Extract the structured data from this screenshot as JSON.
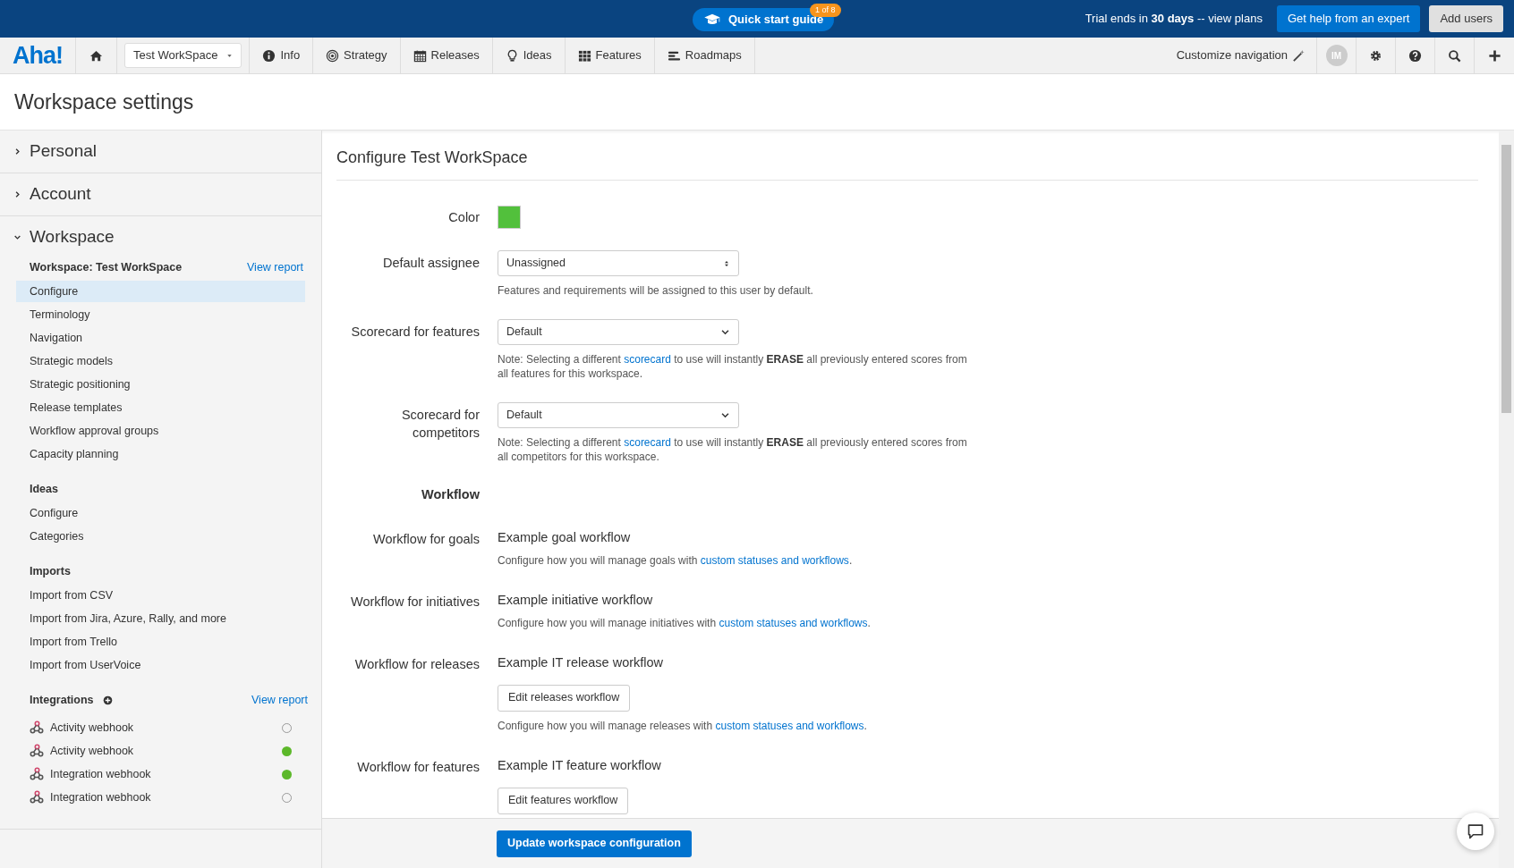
{
  "top_bar": {
    "guide": {
      "label": "Quick start guide",
      "badge": "1 of 8"
    },
    "trial_text": "Trial ends in **30 days** -- view plans",
    "buttons": [
      {
        "label": "Get help from an expert",
        "kind": "primary"
      },
      {
        "label": "Add users",
        "kind": "secondary"
      }
    ]
  },
  "nav": {
    "logo": "Aha!",
    "workspace": "Test WorkSpace",
    "items": [
      {
        "label": "Info"
      },
      {
        "label": "Strategy"
      },
      {
        "label": "Releases"
      },
      {
        "label": "Ideas"
      },
      {
        "label": "Features"
      },
      {
        "label": "Roadmaps"
      }
    ],
    "customize": "Customize navigation",
    "avatar": "IM"
  },
  "page_title": "Workspace settings",
  "sidebar": {
    "sections": [
      {
        "label": "Personal",
        "expanded": false
      },
      {
        "label": "Account",
        "expanded": false
      },
      {
        "label": "Workspace",
        "expanded": true,
        "groups": [
          {
            "title": "Workspace: Test WorkSpace",
            "link": "View report",
            "items": [
              {
                "label": "Configure",
                "selected": true
              },
              {
                "label": "Terminology",
                "selected": false
              },
              {
                "label": "Navigation",
                "selected": false
              },
              {
                "label": "Strategic models",
                "selected": false
              },
              {
                "label": "Strategic positioning",
                "selected": false
              },
              {
                "label": "Release templates",
                "selected": false
              },
              {
                "label": "Workflow approval groups",
                "selected": false
              },
              {
                "label": "Capacity planning",
                "selected": false
              }
            ]
          },
          {
            "title": "Ideas",
            "items": [
              {
                "label": "Configure",
                "selected": false
              },
              {
                "label": "Categories",
                "selected": false
              }
            ]
          },
          {
            "title": "Imports",
            "items": [
              {
                "label": "Import from CSV",
                "selected": false
              },
              {
                "label": "Import from Jira, Azure, Rally, and more",
                "selected": false
              },
              {
                "label": "Import from Trello",
                "selected": false
              },
              {
                "label": "Import from UserVoice",
                "selected": false
              }
            ]
          },
          {
            "title": "Integrations",
            "addable": true,
            "link": "View report",
            "integrations": [
              {
                "label": "Activity webhook",
                "active": false
              },
              {
                "label": "Activity webhook",
                "active": true
              },
              {
                "label": "Integration webhook",
                "active": true
              },
              {
                "label": "Integration webhook",
                "active": false
              }
            ]
          }
        ]
      }
    ]
  },
  "form": {
    "title": "Configure Test WorkSpace",
    "rows": [
      {
        "kind": "color",
        "label": "Color",
        "color": "#52c03c"
      },
      {
        "kind": "picker",
        "label": "Default assignee",
        "value": "Unassigned",
        "help": {
          "text": "Features and requirements will be assigned to this user by default."
        }
      },
      {
        "kind": "select",
        "label": "Scorecard for features",
        "value": "Default",
        "help": {
          "text": "Note: Selecting a different ",
          "link": "scorecard",
          "after": " to use will instantly **ERASE** all previously entered scores from all features for this workspace."
        }
      },
      {
        "kind": "select",
        "label": "Scorecard for competitors",
        "value": "Default",
        "help": {
          "text": "Note: Selecting a different ",
          "link": "scorecard",
          "after": " to use will instantly **ERASE** all previously entered scores from all competitors for this workspace."
        }
      },
      {
        "kind": "heading",
        "label": "Workflow"
      },
      {
        "kind": "workflow",
        "label": "Workflow for goals",
        "value": "Example goal workflow",
        "help": {
          "text": "Configure how you will manage goals with ",
          "link": "custom statuses and workflows",
          "after": "."
        }
      },
      {
        "kind": "workflow",
        "label": "Workflow for initiatives",
        "value": "Example initiative workflow",
        "help": {
          "text": "Configure how you will manage initiatives with ",
          "link": "custom statuses and workflows",
          "after": "."
        }
      },
      {
        "kind": "workflow",
        "label": "Workflow for releases",
        "value": "Example IT release workflow",
        "button": "Edit releases workflow",
        "help": {
          "text": "Configure how you will manage releases with ",
          "link": "custom statuses and workflows",
          "after": "."
        }
      },
      {
        "kind": "workflow",
        "label": "Workflow for features",
        "value": "Example IT feature workflow",
        "button": "Edit features workflow"
      }
    ],
    "submit": "Update workspace configuration"
  }
}
